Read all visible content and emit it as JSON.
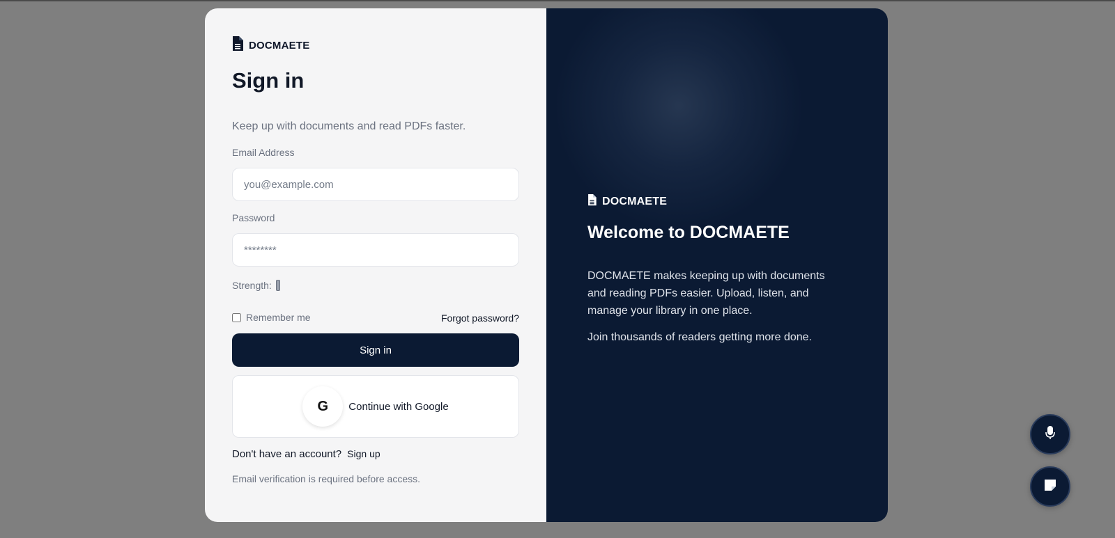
{
  "brand": {
    "name": "DOCMAETE",
    "icon": "document-icon"
  },
  "signin": {
    "title": "Sign in",
    "subtitle": "Keep up with documents and read PDFs faster.",
    "email_label": "Email Address",
    "email_placeholder": "you@example.com",
    "email_value": "",
    "password_label": "Password",
    "password_placeholder": "********",
    "password_value": "",
    "strength_label": "Strength:",
    "remember_label": "Remember me",
    "remember_checked": false,
    "forgot_label": "Forgot password?",
    "submit_label": "Sign in",
    "google_icon_text": "G",
    "google_label": "Continue with Google",
    "no_account_text": "Don't have an account?",
    "signup_label": "Sign up",
    "verify_note": "Email verification is required before access."
  },
  "welcome": {
    "title": "Welcome to DOCMAETE",
    "description": "DOCMAETE makes keeping up with documents and reading PDFs easier. Upload, listen, and manage your library in one place.",
    "tagline": "Join thousands of readers getting more done."
  },
  "floating_buttons": [
    {
      "icon": "microphone-icon"
    },
    {
      "icon": "chat-icon"
    }
  ],
  "colors": {
    "primary": "#0b1a33",
    "panel_light": "#f5f5f6",
    "backdrop": "#7f7f7f",
    "muted_text": "#6b7280"
  }
}
